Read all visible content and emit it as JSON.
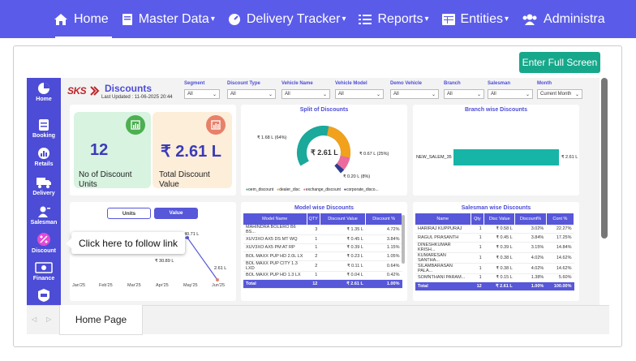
{
  "nav": {
    "items": [
      {
        "label": "Home",
        "icon": "home-icon",
        "active": true
      },
      {
        "label": "Master Data",
        "icon": "book-icon",
        "caret": "▾"
      },
      {
        "label": "Delivery Tracker",
        "icon": "gauge-icon",
        "caret": "▾"
      },
      {
        "label": "Reports",
        "icon": "list-icon",
        "caret": "▾"
      },
      {
        "label": "Entities",
        "icon": "table-icon",
        "caret": "▾"
      },
      {
        "label": "Administra",
        "icon": "users-icon"
      }
    ]
  },
  "fullscreen_label": "Enter Full Screen",
  "report": {
    "logo": "SKS",
    "title": "Discounts",
    "updated": "Last Updated : 11-06-2025 20:44",
    "filters": [
      {
        "label": "Segment",
        "value": "All"
      },
      {
        "label": "Discount Type",
        "value": "All"
      },
      {
        "label": "Vehicle Name",
        "value": "All"
      },
      {
        "label": "Vehicle Model",
        "value": "All"
      },
      {
        "label": "Demo Vehicle",
        "value": "All"
      },
      {
        "label": "Branch",
        "value": "All"
      },
      {
        "label": "Salesman",
        "value": "All"
      },
      {
        "label": "Month",
        "value": "Current Month"
      }
    ],
    "sidebar": [
      {
        "label": "Home",
        "icon": "pie-icon"
      },
      {
        "label": "Booking",
        "icon": "booking-icon"
      },
      {
        "label": "Retails",
        "icon": "retails-icon"
      },
      {
        "label": "Delivery",
        "icon": "truck-icon"
      },
      {
        "label": "Salesman",
        "icon": "salesman-icon"
      },
      {
        "label": "Discount",
        "icon": "discount-icon"
      },
      {
        "label": "Finance",
        "icon": "finance-icon"
      },
      {
        "label": "",
        "icon": "vehicle-icon"
      }
    ],
    "kpi_units": {
      "value": "12",
      "label": "No of Discount Units"
    },
    "kpi_value": {
      "value": "₹ 2.61 L",
      "label": "Total Discount Value"
    },
    "split": {
      "title": "Split of Discounts",
      "center": "₹ 2.61 L",
      "labels": [
        "₹ 1.68 L (64%)",
        "₹ 0.67 L (25%)",
        "₹ 0.20 L (8%)"
      ],
      "legend": [
        "oem_discount",
        "dealer_disc",
        "exchange_discount",
        "corporate_disco..."
      ],
      "colors": [
        "#1aa99b",
        "#f2a11c",
        "#ec6b9c",
        "#2f3b8c"
      ]
    },
    "branch": {
      "title": "Branch wise Discounts",
      "name": "NEW_SALEM_35",
      "value": "₹ 2.61 L"
    },
    "trend": {
      "toggle_units": "Units",
      "toggle_value": "Value",
      "months": [
        "Jan'25",
        "Feb'25",
        "Mar'25",
        "Apr'25",
        "May'25",
        "Jun'25"
      ],
      "labels": [
        "₹ 30.89 L",
        "40.71 L",
        "2.61 L"
      ]
    },
    "tooltip": "Click here to follow link",
    "model_table": {
      "title": "Model wise Discounts",
      "headers": [
        "Model Name",
        "QTY",
        "Discount Value",
        "Discount %"
      ],
      "rows": [
        [
          "MAHINDRA BOLERO B6 BS...",
          "3",
          "₹ 1.35 L",
          "4.72%"
        ],
        [
          "XUV3XO AX5 DS MT WQ",
          "1",
          "₹ 0.45 L",
          "3.84%"
        ],
        [
          "XUV3XO AX5 PM AT RP",
          "1",
          "₹ 0.39 L",
          "1.15%"
        ],
        [
          "BOL MAXX PUP HD 2.0L LX",
          "2",
          "₹ 0.23 L",
          "1.05%"
        ],
        [
          "BOL MAXX PUP CITY 1.3 LXD",
          "2",
          "₹ 0.11 L",
          "0.64%"
        ],
        [
          "BOL MAXX PUP HD 1.3 LX",
          "1",
          "₹ 0.04 L",
          "0.42%"
        ]
      ],
      "total": [
        "Total",
        "12",
        "₹ 2.61 L",
        "1.00%"
      ]
    },
    "salesman_table": {
      "title": "Salesman wise Discounts",
      "headers": [
        "Name",
        "Qty",
        "Disc Value",
        "Discount%",
        "Cont %"
      ],
      "rows": [
        [
          "HARIRAJ KUPPURAJ",
          "1",
          "₹ 0.58 L",
          "3.02%",
          "22.27%"
        ],
        [
          "RAGUL PRASANTH",
          "1",
          "₹ 0.45 L",
          "3.84%",
          "17.25%"
        ],
        [
          "DINESHKUMAR KRISH...",
          "1",
          "₹ 0.39 L",
          "3.15%",
          "14.84%"
        ],
        [
          "KUMARESAN SANTHA...",
          "1",
          "₹ 0.38 L",
          "4.02%",
          "14.62%"
        ],
        [
          "SILAMBARASAN PALA...",
          "1",
          "₹ 0.38 L",
          "4.02%",
          "14.62%"
        ],
        [
          "SOMNTHANI PARAM...",
          "1",
          "₹ 0.15 L",
          "1.38%",
          "5.60%"
        ]
      ],
      "total": [
        "Total",
        "12",
        "₹ 2.61 L",
        "1.00%",
        "100.00%"
      ]
    }
  },
  "bottom_tab": "Home Page",
  "colors": {
    "nav": "#5b5bea",
    "accent": "#4c4cd6",
    "teal": "#17a88b"
  }
}
